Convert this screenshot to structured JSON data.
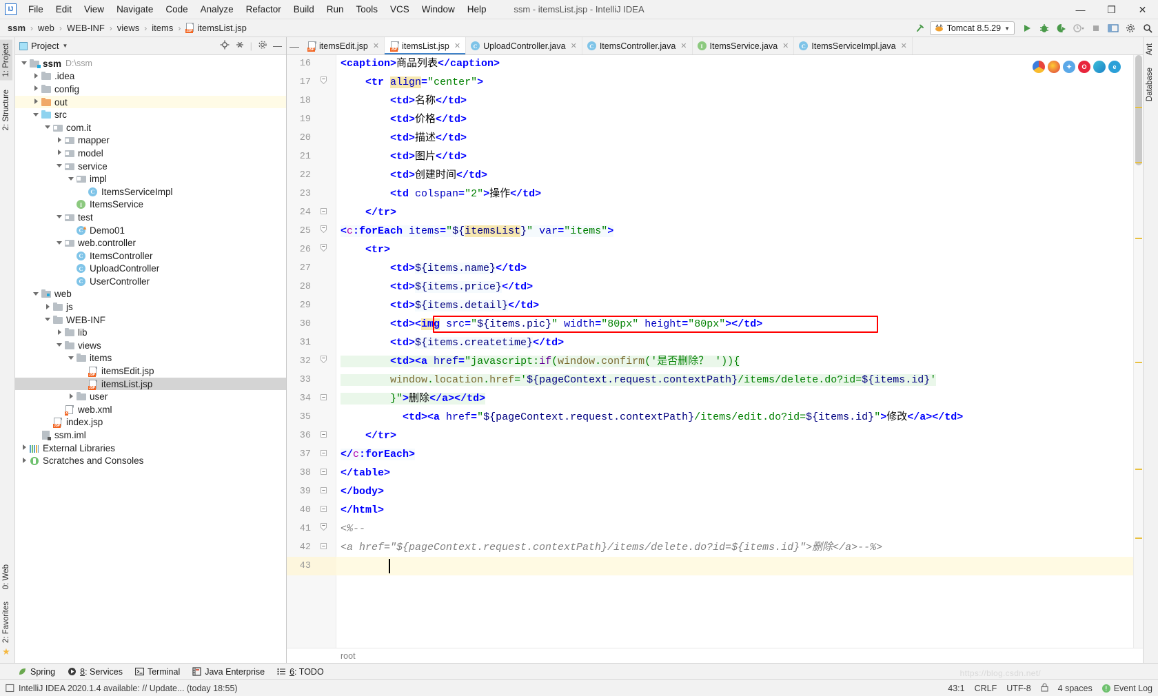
{
  "window": {
    "title": "ssm - itemsList.jsp - IntelliJ IDEA",
    "logo": "IJ",
    "minimize": "—",
    "maximize": "❐",
    "close": "✕"
  },
  "menu": {
    "items": [
      "File",
      "Edit",
      "View",
      "Navigate",
      "Code",
      "Analyze",
      "Refactor",
      "Build",
      "Run",
      "Tools",
      "VCS",
      "Window",
      "Help"
    ]
  },
  "breadcrumb": {
    "items": [
      "ssm",
      "web",
      "WEB-INF",
      "views",
      "items",
      "itemsList.jsp"
    ],
    "separator": "›"
  },
  "toolbar": {
    "run_config": "Tomcat 8.5.29",
    "dropdown_arrow": "▼",
    "update_arrow_icon": "update-arrow-icon",
    "run_icon": "run-icon",
    "debug_icon": "debug-icon",
    "run_coverage_icon": "run-with-coverage-icon",
    "profile_icon": "profile-icon",
    "stop_icon": "stop-icon",
    "layout_icon": "layout-icon",
    "settings_icon": "settings-icon",
    "search_icon": "search-icon"
  },
  "left_strip": {
    "top": [
      "1: Project",
      "2: Structure"
    ],
    "bottom": [
      "0: Web",
      "2: Favorites"
    ]
  },
  "right_strip": {
    "items": [
      "Ant",
      "Database"
    ]
  },
  "project_panel": {
    "title": "Project",
    "dropdown_arrow": "▼",
    "locate_icon": "locate-icon",
    "collapse_all_icon": "collapse-all-icon",
    "gear_icon": "gear-icon",
    "tree": [
      {
        "label": "ssm",
        "sub": "D:\\ssm",
        "indent": 0,
        "arrow": "down",
        "icon": "module-folder",
        "bold": true,
        "state": "normal"
      },
      {
        "label": ".idea",
        "sub": "",
        "indent": 1,
        "arrow": "right",
        "icon": "folder-grey",
        "bold": false,
        "state": "normal"
      },
      {
        "label": "config",
        "sub": "",
        "indent": 1,
        "arrow": "right",
        "icon": "folder-grey",
        "bold": false,
        "state": "normal"
      },
      {
        "label": "out",
        "sub": "",
        "indent": 1,
        "arrow": "right",
        "icon": "folder-orange",
        "bold": false,
        "state": "highlight"
      },
      {
        "label": "src",
        "sub": "",
        "indent": 1,
        "arrow": "down",
        "icon": "folder-blue",
        "bold": false,
        "state": "normal"
      },
      {
        "label": "com.it",
        "sub": "",
        "indent": 2,
        "arrow": "down",
        "icon": "package",
        "bold": false,
        "state": "normal"
      },
      {
        "label": "mapper",
        "sub": "",
        "indent": 3,
        "arrow": "right",
        "icon": "package",
        "bold": false,
        "state": "normal"
      },
      {
        "label": "model",
        "sub": "",
        "indent": 3,
        "arrow": "right",
        "icon": "package",
        "bold": false,
        "state": "normal"
      },
      {
        "label": "service",
        "sub": "",
        "indent": 3,
        "arrow": "down",
        "icon": "package",
        "bold": false,
        "state": "normal"
      },
      {
        "label": "impl",
        "sub": "",
        "indent": 4,
        "arrow": "down",
        "icon": "package",
        "bold": false,
        "state": "normal"
      },
      {
        "label": "ItemsServiceImpl",
        "sub": "",
        "indent": 5,
        "arrow": "none",
        "icon": "class",
        "bold": false,
        "state": "normal"
      },
      {
        "label": "ItemsService",
        "sub": "",
        "indent": 4,
        "arrow": "none",
        "icon": "interface",
        "bold": false,
        "state": "normal"
      },
      {
        "label": "test",
        "sub": "",
        "indent": 3,
        "arrow": "down",
        "icon": "package",
        "bold": false,
        "state": "normal"
      },
      {
        "label": "Demo01",
        "sub": "",
        "indent": 4,
        "arrow": "none",
        "icon": "class-run",
        "bold": false,
        "state": "normal"
      },
      {
        "label": "web.controller",
        "sub": "",
        "indent": 3,
        "arrow": "down",
        "icon": "package",
        "bold": false,
        "state": "normal"
      },
      {
        "label": "ItemsController",
        "sub": "",
        "indent": 4,
        "arrow": "none",
        "icon": "class",
        "bold": false,
        "state": "normal"
      },
      {
        "label": "UploadController",
        "sub": "",
        "indent": 4,
        "arrow": "none",
        "icon": "class",
        "bold": false,
        "state": "normal"
      },
      {
        "label": "UserController",
        "sub": "",
        "indent": 4,
        "arrow": "none",
        "icon": "class",
        "bold": false,
        "state": "normal"
      },
      {
        "label": "web",
        "sub": "",
        "indent": 1,
        "arrow": "down",
        "icon": "web-folder",
        "bold": false,
        "state": "normal"
      },
      {
        "label": "js",
        "sub": "",
        "indent": 2,
        "arrow": "right",
        "icon": "folder-grey",
        "bold": false,
        "state": "normal"
      },
      {
        "label": "WEB-INF",
        "sub": "",
        "indent": 2,
        "arrow": "down",
        "icon": "folder-grey",
        "bold": false,
        "state": "normal"
      },
      {
        "label": "lib",
        "sub": "",
        "indent": 3,
        "arrow": "right",
        "icon": "folder-grey",
        "bold": false,
        "state": "normal"
      },
      {
        "label": "views",
        "sub": "",
        "indent": 3,
        "arrow": "down",
        "icon": "folder-grey",
        "bold": false,
        "state": "normal"
      },
      {
        "label": "items",
        "sub": "",
        "indent": 4,
        "arrow": "down",
        "icon": "folder-grey",
        "bold": false,
        "state": "normal"
      },
      {
        "label": "itemsEdit.jsp",
        "sub": "",
        "indent": 5,
        "arrow": "none",
        "icon": "jsp",
        "bold": false,
        "state": "normal"
      },
      {
        "label": "itemsList.jsp",
        "sub": "",
        "indent": 5,
        "arrow": "none",
        "icon": "jsp",
        "bold": false,
        "state": "selected"
      },
      {
        "label": "user",
        "sub": "",
        "indent": 4,
        "arrow": "right",
        "icon": "folder-grey",
        "bold": false,
        "state": "normal"
      },
      {
        "label": "web.xml",
        "sub": "",
        "indent": 3,
        "arrow": "none",
        "icon": "xml",
        "bold": false,
        "state": "normal"
      },
      {
        "label": "index.jsp",
        "sub": "",
        "indent": 2,
        "arrow": "none",
        "icon": "jsp",
        "bold": false,
        "state": "normal"
      },
      {
        "label": "ssm.iml",
        "sub": "",
        "indent": 1,
        "arrow": "none",
        "icon": "iml",
        "bold": false,
        "state": "normal"
      },
      {
        "label": "External Libraries",
        "sub": "",
        "indent": 0,
        "arrow": "right",
        "icon": "libraries",
        "bold": false,
        "state": "normal"
      },
      {
        "label": "Scratches and Consoles",
        "sub": "",
        "indent": 0,
        "arrow": "right",
        "icon": "scratches",
        "bold": false,
        "state": "normal"
      }
    ]
  },
  "editor": {
    "collapse_icon": "collapse-tabs-icon",
    "tabs": [
      {
        "label": "itemsEdit.jsp",
        "icon": "jsp",
        "active": false,
        "close": "✕"
      },
      {
        "label": "itemsList.jsp",
        "icon": "jsp",
        "active": true,
        "close": "✕"
      },
      {
        "label": "UploadController.java",
        "icon": "class",
        "active": false,
        "close": "✕"
      },
      {
        "label": "ItemsController.java",
        "icon": "class",
        "active": false,
        "close": "✕"
      },
      {
        "label": "ItemsService.java",
        "icon": "interface",
        "active": false,
        "close": "✕"
      },
      {
        "label": "ItemsServiceImpl.java",
        "icon": "class",
        "active": false,
        "close": "✕"
      }
    ],
    "breadcrumb": "root",
    "first_line": 16,
    "last_line": 43,
    "current_line": 43,
    "lines": [
      {
        "n": 16,
        "fold": "none"
      },
      {
        "n": 17,
        "fold": "open"
      },
      {
        "n": 18,
        "fold": "none"
      },
      {
        "n": 19,
        "fold": "none"
      },
      {
        "n": 20,
        "fold": "none"
      },
      {
        "n": 21,
        "fold": "none"
      },
      {
        "n": 22,
        "fold": "none"
      },
      {
        "n": 23,
        "fold": "none"
      },
      {
        "n": 24,
        "fold": "close"
      },
      {
        "n": 25,
        "fold": "open"
      },
      {
        "n": 26,
        "fold": "open"
      },
      {
        "n": 27,
        "fold": "none"
      },
      {
        "n": 28,
        "fold": "none"
      },
      {
        "n": 29,
        "fold": "none"
      },
      {
        "n": 30,
        "fold": "none"
      },
      {
        "n": 31,
        "fold": "none"
      },
      {
        "n": 32,
        "fold": "open"
      },
      {
        "n": 33,
        "fold": "none"
      },
      {
        "n": 34,
        "fold": "close"
      },
      {
        "n": 35,
        "fold": "none"
      },
      {
        "n": 36,
        "fold": "close"
      },
      {
        "n": 37,
        "fold": "close"
      },
      {
        "n": 38,
        "fold": "close"
      },
      {
        "n": 39,
        "fold": "close"
      },
      {
        "n": 40,
        "fold": "close"
      },
      {
        "n": 41,
        "fold": "open"
      },
      {
        "n": 42,
        "fold": "close"
      },
      {
        "n": 43,
        "fold": "none"
      }
    ],
    "code_text": [
      "<caption>商品列表</caption>",
      "    <tr align=\"center\">",
      "        <td>名称</td>",
      "        <td>价格</td>",
      "        <td>描述</td>",
      "        <td>图片</td>",
      "        <td>创建时间</td>",
      "        <td colspan=\"2\">操作</td>",
      "    </tr>",
      "<c:forEach items=\"${itemsList}\" var=\"items\">",
      "    <tr>",
      "        <td>${items.name}</td>",
      "        <td>${items.price}</td>",
      "        <td>${items.detail}</td>",
      "        <td><img src=\"${items.pic}\" width=\"80px\" height=\"80px\"></td>",
      "        <td>${items.createtime}</td>",
      "        <td><a href=\"javascript:if(window.confirm('是否删除？ ')){",
      "        window.location.href='${pageContext.request.contextPath}/items/delete.do?id=${items.id}'",
      "        }\">删除</a></td>",
      "          <td><a href=\"${pageContext.request.contextPath}/items/edit.do?id=${items.id}\">修改</a></td>",
      "    </tr>",
      "</c:forEach>",
      "</table>",
      "</body>",
      "</html>",
      "<%--",
      "<a href=\"${pageContext.request.contextPath}/items/delete.do?id=${items.id}\">删除</a>--%>",
      ""
    ],
    "browser_icons": [
      "chrome-icon",
      "firefox-icon",
      "safari-icon",
      "opera-icon",
      "edge-icon",
      "ie-icon"
    ],
    "highlight_box_line": 30
  },
  "bottom_tools": [
    {
      "label": "Spring",
      "num": "",
      "icon": "spring-leaf-icon"
    },
    {
      "label": "Services",
      "num": "8",
      "icon": "services-icon"
    },
    {
      "label": "Terminal",
      "num": "",
      "icon": "terminal-icon"
    },
    {
      "label": "Java Enterprise",
      "num": "",
      "icon": "java-enterprise-icon"
    },
    {
      "label": "TODO",
      "num": "6",
      "icon": "todo-icon"
    }
  ],
  "status": {
    "message": "IntelliJ IDEA 2020.1.4 available: // Update... (today 18:55)",
    "message_icon": "notification-icon",
    "caret_position": "43:1",
    "line_separator": "CRLF",
    "encoding": "UTF-8",
    "lock_icon": "lock-icon",
    "indent": "4 spaces",
    "event_log": "Event Log",
    "event_log_icon": "event-log-icon",
    "watermark": "https://blog.csdn.net/"
  },
  "colors": {
    "accent": "#4083c9",
    "tag": "#0000c0",
    "element": "#0000ff",
    "string": "#008000",
    "namespace": "#b000b0",
    "highlight_box": "#ff0000",
    "identifier_highlight": "#f7e8b0",
    "current_line": "#fffae3",
    "selection_tree": "#d4d4d4"
  }
}
